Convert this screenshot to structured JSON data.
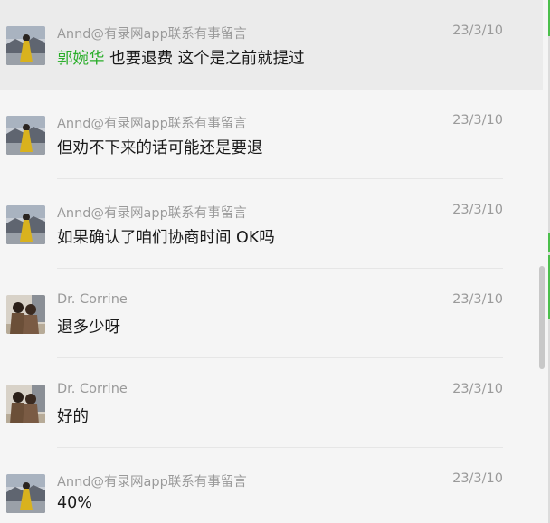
{
  "messages": [
    {
      "sender": "Annd@有录网app联系有事留言",
      "time": "23/3/10",
      "mention": "郭婉华",
      "text": " 也要退费 这个是之前就提过",
      "avatar": "avatar-yellow-dress"
    },
    {
      "sender": "Annd@有录网app联系有事留言",
      "time": "23/3/10",
      "text": "但劝不下来的话可能还是要退",
      "avatar": "avatar-yellow-dress"
    },
    {
      "sender": "Annd@有录网app联系有事留言",
      "time": "23/3/10",
      "text": "如果确认了咱们协商时间 OK吗",
      "avatar": "avatar-yellow-dress"
    },
    {
      "sender": "Dr. Corrine",
      "time": "23/3/10",
      "text": "退多少呀",
      "avatar": "avatar-two-people"
    },
    {
      "sender": "Dr. Corrine",
      "time": "23/3/10",
      "text": "好的",
      "avatar": "avatar-two-people"
    },
    {
      "sender": "Annd@有录网app联系有事留言",
      "time": "23/3/10",
      "text": "40%",
      "avatar": "avatar-yellow-dress"
    }
  ],
  "colors": {
    "background": "#f5f5f5",
    "highlight": "#ebebeb",
    "mention": "#2aae2a",
    "meta_text": "#9a9a9a",
    "body_text": "#1a1a1a"
  }
}
